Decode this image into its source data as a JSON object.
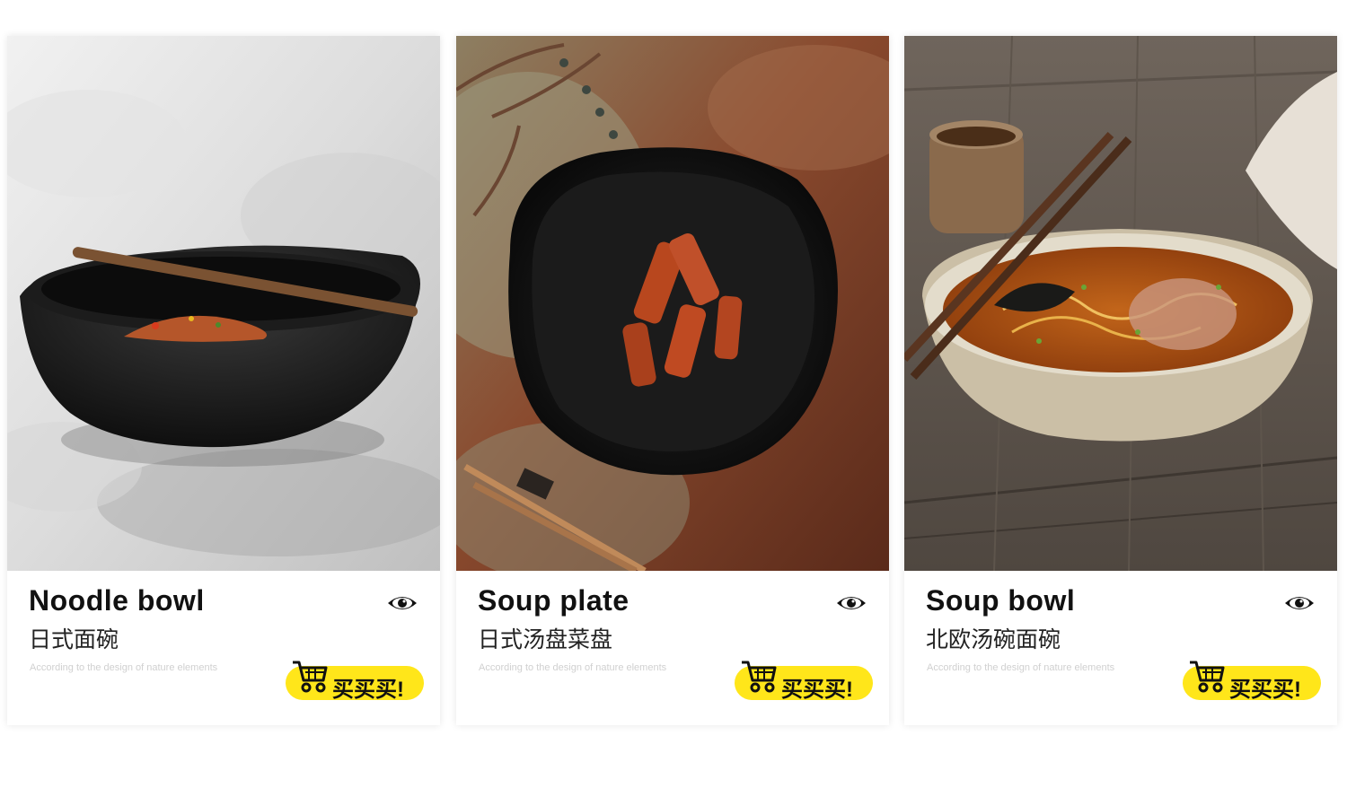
{
  "products": [
    {
      "title": "Noodle bowl",
      "subtitle": "日式面碗",
      "description": "According to the design of nature elements",
      "buy_label": "买买买!",
      "photo_icon": "noodle-bowl-photo"
    },
    {
      "title": "Soup plate",
      "subtitle": "日式汤盘菜盘",
      "description": "According to the design of nature elements",
      "buy_label": "买买买!",
      "photo_icon": "soup-plate-photo"
    },
    {
      "title": "Soup bowl",
      "subtitle": "北欧汤碗面碗",
      "description": "According to the design of nature elements",
      "buy_label": "买买买!",
      "photo_icon": "soup-bowl-photo"
    }
  ],
  "colors": {
    "buy_button": "#ffe61a",
    "title_text": "#111111",
    "description_text": "#d0d0d0"
  }
}
